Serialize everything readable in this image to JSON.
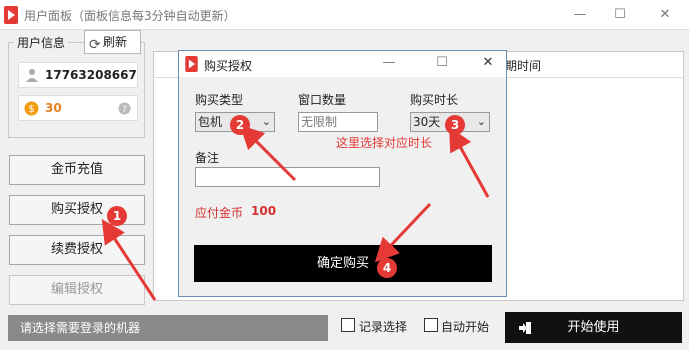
{
  "main_window": {
    "title": "用户面板（面板信息每3分钟自动更新）",
    "controls": {
      "minimize": "—",
      "maximize": "☐",
      "close": "✕"
    }
  },
  "left_panel": {
    "group_label": "用户信息",
    "refresh_label": "刷新",
    "phone": "17763208667",
    "coins": "30",
    "buttons": {
      "recharge": "金币充值",
      "buy_license": "购买授权",
      "renew_license": "续费授权",
      "edit_license": "编辑授权"
    }
  },
  "table": {
    "col_time": "期时间"
  },
  "bottom": {
    "hint": "请选择需要登录的机器",
    "record_choice": "记录选择",
    "auto_start": "自动开始",
    "start_button": "开始使用"
  },
  "dialog": {
    "title": "购买授权",
    "controls": {
      "minimize": "—",
      "maximize": "☐",
      "close": "✕"
    },
    "buy_type_label": "购买类型",
    "buy_type_value": "包机",
    "window_count_label": "窗口数量",
    "window_count_value": "无限制",
    "duration_label": "购买时长",
    "duration_value": "30天",
    "remark_label": "备注",
    "remark_value": "",
    "pay_label": "应付金币",
    "pay_value": "100",
    "confirm_button": "确定购买"
  },
  "annotations": {
    "note": "这里选择对应时长",
    "badges": [
      "1",
      "2",
      "3",
      "4"
    ],
    "color": "#e53935"
  }
}
